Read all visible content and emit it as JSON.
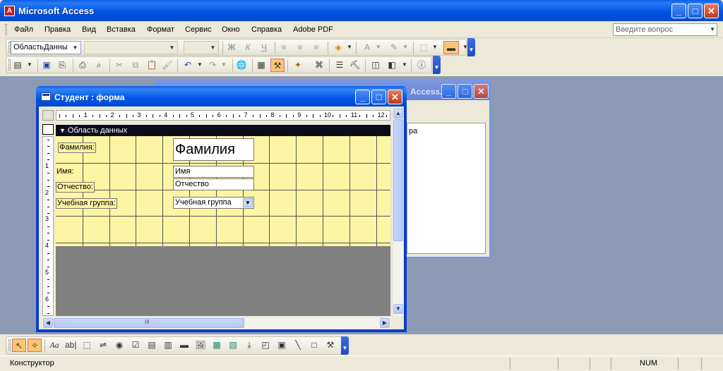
{
  "app": {
    "title": "Microsoft Access",
    "icon_letter": "A"
  },
  "caption_buttons": {
    "minimize": "_",
    "maximize": "□",
    "close": "✕"
  },
  "menu": [
    "Файл",
    "Правка",
    "Вид",
    "Вставка",
    "Формат",
    "Сервис",
    "Окно",
    "Справка",
    "Adobe PDF"
  ],
  "ask_box": {
    "placeholder": "Введите вопрос"
  },
  "format_toolbar": {
    "object_combo": "ОбластьДанны",
    "font_combo": "",
    "size_combo": ""
  },
  "bg_window": {
    "title_fragment": "Access...",
    "pane_text": "ра"
  },
  "form_window": {
    "title": "Студент : форма",
    "section_label": "Область данных",
    "ruler_h": [
      "1",
      "2",
      "3",
      "4",
      "5",
      "6",
      "7",
      "8",
      "9",
      "10",
      "11",
      "12"
    ],
    "ruler_v": [
      "1",
      "2",
      "3",
      "4",
      "5",
      "6"
    ],
    "labels": {
      "lastname": "Фамилия:",
      "firstname": "Имя:",
      "patronymic": "Отчество:",
      "group": "Учебная группа:"
    },
    "fields": {
      "lastname": "Фамилия",
      "firstname": "Имя",
      "patronymic": "Отчество",
      "group": "Учебная группа"
    },
    "scroll_mark": "III"
  },
  "status": {
    "text": "Конструктор",
    "num": "NUM"
  },
  "colors": {
    "title_blue": "#0055e5",
    "grid_yellow": "#fdf5a4",
    "mdi_bg": "#8d9ab6",
    "section_bar": "#0b0b1c"
  }
}
